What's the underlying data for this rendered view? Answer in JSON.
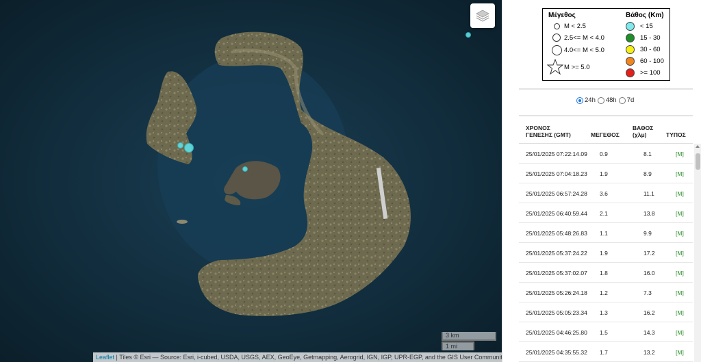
{
  "map": {
    "scale_km": "3 km",
    "scale_mi": "1 mi",
    "attribution_link": "Leaflet",
    "attribution_text": " | Tiles © Esri — Source: Esri, i-cubed, USDA, USGS, AEX, GeoEye, Getmapping, Aerogrid, IGN, IGP, UPR-EGP, and the GIS User Community",
    "layers_icon": "layers-icon",
    "marker_color": "#5fe0e6"
  },
  "legend": {
    "magnitude_title": "Μέγεθος",
    "depth_title": "Βάθος (Km)",
    "magnitudes": [
      "M < 2.5",
      "2.5<= M < 4.0",
      "4.0<= M < 5.0",
      "M >= 5.0"
    ],
    "depths": [
      {
        "label": "< 15",
        "color": "#7fe9ec"
      },
      {
        "label": "15 - 30",
        "color": "#1f8f2a"
      },
      {
        "label": "30 - 60",
        "color": "#f5ef16"
      },
      {
        "label": "60 - 100",
        "color": "#f0861f"
      },
      {
        "label": ">= 100",
        "color": "#e3201b"
      }
    ]
  },
  "time_filter": {
    "options": [
      "24h",
      "48h",
      "7d"
    ],
    "selected": "24h"
  },
  "table": {
    "headers": {
      "time_line1": "ΧΡΟΝΟΣ",
      "time_line2": "ΓΕΝΕΣΗΣ (GMT)",
      "magnitude": "ΜΕΓΕΘΟΣ",
      "depth_line1": "ΒΑΘΟΣ",
      "depth_line2": "(χλμ)",
      "type": "ΤΥΠΟΣ"
    },
    "rows": [
      {
        "time": "25/01/2025 07:22:14.09",
        "mag": "0.9",
        "depth": "8.1",
        "type": "[M]"
      },
      {
        "time": "25/01/2025 07:04:18.23",
        "mag": "1.9",
        "depth": "8.9",
        "type": "[M]"
      },
      {
        "time": "25/01/2025 06:57:24.28",
        "mag": "3.6",
        "depth": "11.1",
        "type": "[M]"
      },
      {
        "time": "25/01/2025 06:40:59.44",
        "mag": "2.1",
        "depth": "13.8",
        "type": "[M]"
      },
      {
        "time": "25/01/2025 05:48:26.83",
        "mag": "1.1",
        "depth": "9.9",
        "type": "[M]"
      },
      {
        "time": "25/01/2025 05:37:24.22",
        "mag": "1.9",
        "depth": "17.2",
        "type": "[M]"
      },
      {
        "time": "25/01/2025 05:37:02.07",
        "mag": "1.8",
        "depth": "16.0",
        "type": "[M]"
      },
      {
        "time": "25/01/2025 05:26:24.18",
        "mag": "1.2",
        "depth": "7.3",
        "type": "[M]"
      },
      {
        "time": "25/01/2025 05:05:23.34",
        "mag": "1.3",
        "depth": "16.2",
        "type": "[M]"
      },
      {
        "time": "25/01/2025 04:46:25.80",
        "mag": "1.5",
        "depth": "14.3",
        "type": "[M]"
      },
      {
        "time": "25/01/2025 04:35:55.32",
        "mag": "1.7",
        "depth": "13.2",
        "type": "[M]"
      }
    ]
  }
}
